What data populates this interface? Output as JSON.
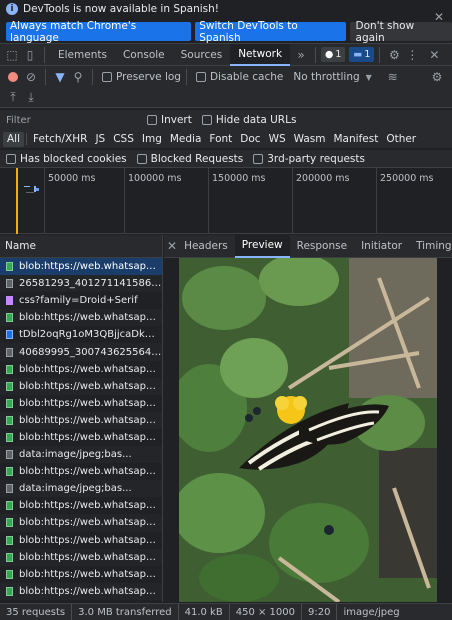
{
  "infobar": {
    "message": "DevTools is now available in Spanish!",
    "btn_match": "Always match Chrome's language",
    "btn_switch": "Switch DevTools to Spanish",
    "btn_dismiss": "Don't show again"
  },
  "tabs": [
    "Elements",
    "Console",
    "Sources",
    "Network"
  ],
  "active_tab": "Network",
  "issues_count": "1",
  "messages_count": "1",
  "toolbar": {
    "preserve_log": "Preserve log",
    "disable_cache": "Disable cache",
    "throttling": "No throttling"
  },
  "filter": {
    "placeholder": "Filter",
    "invert": "Invert",
    "hide_data_urls": "Hide data URLs"
  },
  "types": [
    "All",
    "Fetch/XHR",
    "JS",
    "CSS",
    "Img",
    "Media",
    "Font",
    "Doc",
    "WS",
    "Wasm",
    "Manifest",
    "Other"
  ],
  "blocked": {
    "has_blocked_cookies": "Has blocked cookies",
    "blocked_requests": "Blocked Requests",
    "third_party": "3rd-party requests"
  },
  "overview": {
    "ticks": [
      "50000 ms",
      "100000 ms",
      "150000 ms",
      "200000 ms",
      "250000 ms"
    ]
  },
  "list": {
    "header": "Name",
    "requests": [
      {
        "name": "blob:https://web.whatsapp.c...",
        "type": "blob",
        "selected": true
      },
      {
        "name": "26581293_40127114158656...",
        "type": "img"
      },
      {
        "name": "css?family=Droid+Serif",
        "type": "css"
      },
      {
        "name": "blob:https://web.whatsapp.c...",
        "type": "blob"
      },
      {
        "name": "tDbl2oqRg1oM3QBjjcaDkOr...",
        "type": "font"
      },
      {
        "name": "40689995_30074362556440...",
        "type": "img"
      },
      {
        "name": "blob:https://web.whatsapp.c...",
        "type": "blob"
      },
      {
        "name": "blob:https://web.whatsapp.c...",
        "type": "blob"
      },
      {
        "name": "blob:https://web.whatsapp.c...",
        "type": "blob"
      },
      {
        "name": "blob:https://web.whatsapp.c...",
        "type": "blob"
      },
      {
        "name": "blob:https://web.whatsapp.c...",
        "type": "blob"
      },
      {
        "name": "data:image/jpeg;bas...",
        "type": "img"
      },
      {
        "name": "blob:https://web.whatsapp.c...",
        "type": "blob"
      },
      {
        "name": "data:image/jpeg;bas...",
        "type": "img"
      },
      {
        "name": "blob:https://web.whatsapp.c...",
        "type": "blob"
      },
      {
        "name": "blob:https://web.whatsapp.c...",
        "type": "blob"
      },
      {
        "name": "blob:https://web.whatsapp.c...",
        "type": "blob"
      },
      {
        "name": "blob:https://web.whatsapp.c...",
        "type": "blob"
      },
      {
        "name": "blob:https://web.whatsapp.c...",
        "type": "blob"
      },
      {
        "name": "blob:https://web.whatsapp.c...",
        "type": "blob"
      }
    ]
  },
  "detail_tabs": [
    "Headers",
    "Preview",
    "Response",
    "Initiator",
    "Timing"
  ],
  "active_detail_tab": "Preview",
  "status": {
    "requests": "35 requests",
    "transferred": "3.0 MB transferred",
    "size": "41.0 kB",
    "dimensions": "450 × 1000",
    "ratio": "9:20",
    "mime": "image/jpeg"
  }
}
